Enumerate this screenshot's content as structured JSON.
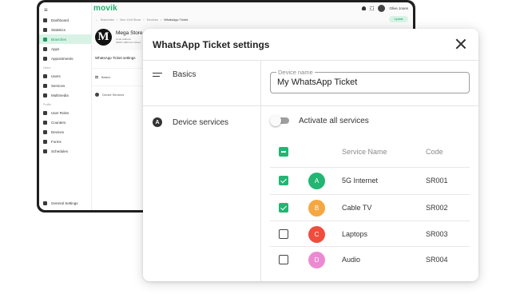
{
  "background_app": {
    "logo": "movik",
    "sidebar": {
      "items": [
        {
          "label": "Dashboard"
        },
        {
          "label": "Statistics"
        },
        {
          "label": "Branches",
          "active": true
        },
        {
          "label": "Apps"
        },
        {
          "label": "Appointments"
        }
      ],
      "section_users": "Users",
      "user_items": [
        {
          "label": "Users"
        },
        {
          "label": "Services"
        },
        {
          "label": "Multimedia"
        }
      ],
      "section_profile": "Profile",
      "profile_items": [
        {
          "label": "User Roles"
        },
        {
          "label": "Counters"
        },
        {
          "label": "Devices"
        },
        {
          "label": "Forms"
        },
        {
          "label": "Schedules"
        }
      ],
      "footer": "General Settings"
    },
    "topbar": {
      "user": "Olive Jones"
    },
    "breadcrumb": [
      "Branches",
      "Non Cell Store",
      "Devices",
      "WhatsApp Ticket"
    ],
    "save_label": "Update",
    "store": {
      "logo_letter": "M",
      "name": "Mega Store",
      "badge": "GT",
      "meta_1": "Code   Address",
      "meta_2": "00001  1000 Fort Street"
    },
    "card": {
      "title": "WhatsApp Ticket settings",
      "row_basics": "Basics",
      "row_services": "Device Services"
    }
  },
  "dialog": {
    "title": "WhatsApp Ticket settings",
    "sections": {
      "basics": {
        "label": "Basics",
        "icon": "lines-icon"
      },
      "device_services": {
        "label": "Device services",
        "icon": "device-icon"
      }
    },
    "device_name": {
      "label": "Device name",
      "value": "My WhatsApp Ticket"
    },
    "activate_all": {
      "label": "Activate all services",
      "on": false
    },
    "table": {
      "columns": {
        "name": "Service Name",
        "code": "Code"
      },
      "header_checkbox": "indeterminate",
      "rows": [
        {
          "letter": "A",
          "name": "5G Internet",
          "code": "SR001",
          "checked": true,
          "color": "#22b573"
        },
        {
          "letter": "B",
          "name": "Cable TV",
          "code": "SR002",
          "checked": true,
          "color": "#f5a742"
        },
        {
          "letter": "C",
          "name": "Laptops",
          "code": "SR003",
          "checked": false,
          "color": "#ef4d3e"
        },
        {
          "letter": "D",
          "name": "Audio",
          "code": "SR004",
          "checked": false,
          "color": "#ec8ad1"
        }
      ]
    }
  },
  "colors": {
    "accent": "#22b573",
    "border": "#e4e4e4"
  }
}
